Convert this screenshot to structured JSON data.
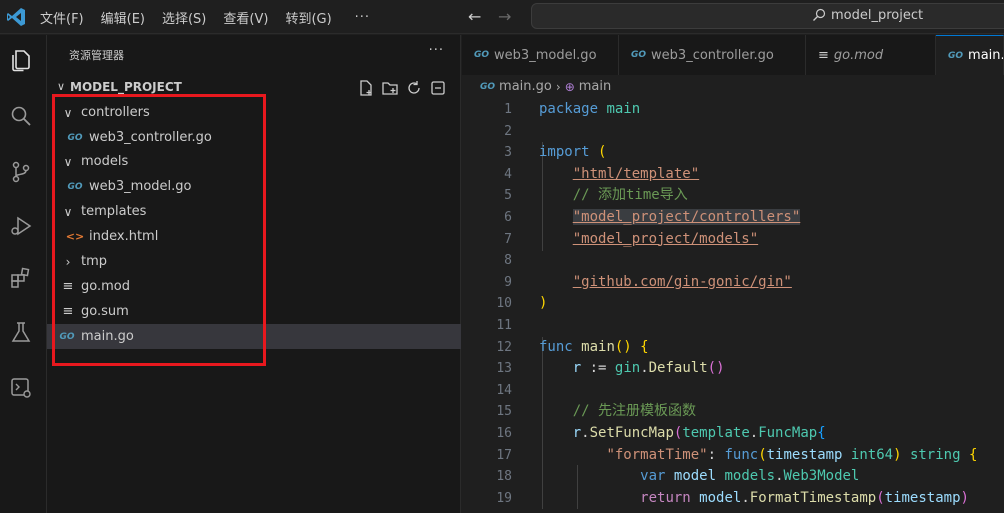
{
  "titlebar": {
    "menu": [
      "文件(F)",
      "编辑(E)",
      "选择(S)",
      "查看(V)",
      "转到(G)"
    ],
    "more": "···",
    "search_text": "model_project"
  },
  "activity": [
    "explorer-icon",
    "search-icon",
    "source-control-icon",
    "run-debug-icon",
    "extensions-icon",
    "testing-icon",
    "remote-explorer-icon"
  ],
  "sidebar": {
    "header": "资源管理器",
    "more": "···",
    "section_title": "MODEL_PROJECT",
    "tree": [
      {
        "label": "controllers",
        "kind": "folder-open"
      },
      {
        "label": "web3_controller.go",
        "kind": "go"
      },
      {
        "label": "models",
        "kind": "folder-open"
      },
      {
        "label": "web3_model.go",
        "kind": "go"
      },
      {
        "label": "templates",
        "kind": "folder-open"
      },
      {
        "label": "index.html",
        "kind": "html"
      },
      {
        "label": "tmp",
        "kind": "folder-closed"
      },
      {
        "label": "go.mod",
        "kind": "lines"
      },
      {
        "label": "go.sum",
        "kind": "lines"
      },
      {
        "label": "main.go",
        "kind": "go"
      }
    ]
  },
  "editor": {
    "tabs": [
      {
        "label": "web3_model.go",
        "icon": "go"
      },
      {
        "label": "web3_controller.go",
        "icon": "go"
      },
      {
        "label": "go.mod",
        "icon": "lines"
      },
      {
        "label": "main.go",
        "icon": "go"
      }
    ],
    "breadcrumb": {
      "file": "main.go",
      "symbol": "main"
    },
    "line_numbers": [
      "1",
      "2",
      "3",
      "4",
      "5",
      "6",
      "7",
      "8",
      "9",
      "10",
      "11",
      "12",
      "13",
      "14",
      "15",
      "16",
      "17",
      "18",
      "19"
    ]
  },
  "colors": {
    "accent": "#0078d4",
    "highlight_box": "#e8181e",
    "go_icon": "#519aba",
    "html_icon": "#e37933"
  }
}
